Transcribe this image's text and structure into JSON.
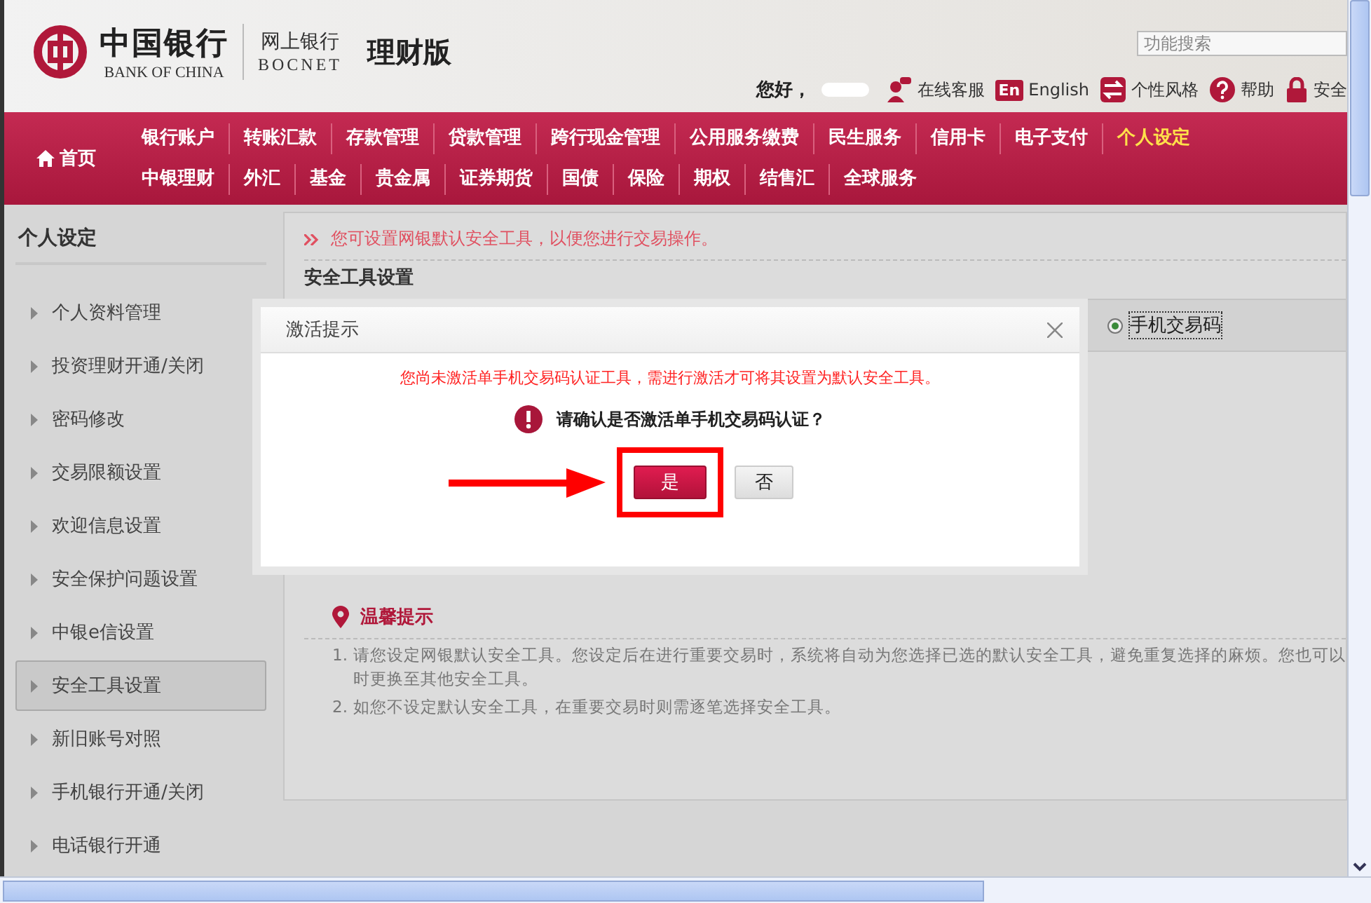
{
  "header": {
    "logo_cn": "中国银行",
    "logo_en": "BANK OF CHINA",
    "product_cn": "网上银行",
    "product_en": "BOCNET",
    "edition": "理财版",
    "search": {
      "placeholder": "功能搜索"
    },
    "greeting": "您好，",
    "links": [
      {
        "kind": "service",
        "label": "在线客服"
      },
      {
        "kind": "english",
        "icon_text": "En",
        "label": "English"
      },
      {
        "kind": "style",
        "label": "个性风格"
      },
      {
        "kind": "help",
        "label": "帮助"
      },
      {
        "kind": "security",
        "label": "安全"
      }
    ]
  },
  "nav": {
    "home": "首页",
    "primary_menu": [
      {
        "label": "银行账户",
        "selected": false
      },
      {
        "label": "转账汇款",
        "selected": false
      },
      {
        "label": "存款管理",
        "selected": false
      },
      {
        "label": "贷款管理",
        "selected": false
      },
      {
        "label": "跨行现金管理",
        "selected": false
      },
      {
        "label": "公用服务缴费",
        "selected": false
      },
      {
        "label": "民生服务",
        "selected": false
      },
      {
        "label": "信用卡",
        "selected": false
      },
      {
        "label": "电子支付",
        "selected": false
      },
      {
        "label": "个人设定",
        "selected": true
      }
    ],
    "secondary_menu": [
      {
        "label": "中银理财",
        "selected": false
      },
      {
        "label": "外汇",
        "selected": false
      },
      {
        "label": "基金",
        "selected": false
      },
      {
        "label": "贵金属",
        "selected": false
      },
      {
        "label": "证券期货",
        "selected": false
      },
      {
        "label": "国债",
        "selected": false
      },
      {
        "label": "保险",
        "selected": false
      },
      {
        "label": "期权",
        "selected": false
      },
      {
        "label": "结售汇",
        "selected": false
      },
      {
        "label": "全球服务",
        "selected": false
      }
    ]
  },
  "sidebar": {
    "title": "个人设定",
    "items": [
      {
        "label": "个人资料管理",
        "selected": false
      },
      {
        "label": "投资理财开通/关闭",
        "selected": false
      },
      {
        "label": "密码修改",
        "selected": false
      },
      {
        "label": "交易限额设置",
        "selected": false
      },
      {
        "label": "欢迎信息设置",
        "selected": false
      },
      {
        "label": "安全保护问题设置",
        "selected": false
      },
      {
        "label": "中银e信设置",
        "selected": false
      },
      {
        "label": "安全工具设置",
        "selected": true
      },
      {
        "label": "新旧账号对照",
        "selected": false
      },
      {
        "label": "手机银行开通/关闭",
        "selected": false
      },
      {
        "label": "电话银行开通",
        "selected": false
      }
    ]
  },
  "main": {
    "notice": "您可设置网银默认安全工具，以便您进行交易操作。",
    "section_title": "安全工具设置",
    "tool_option": {
      "label": "手机交易码",
      "selected": true
    },
    "tips": {
      "title": "温馨提示",
      "items": [
        {
          "number": "1.",
          "lines": [
            "请您设定网银默认安全工具。您设定后在进行重要交易时，系统将自动为您选择已选的默认安全工具，避免重复选择的麻烦。您也可以",
            "时更换至其他安全工具。"
          ]
        },
        {
          "number": "2.",
          "lines": [
            "如您不设定默认安全工具，在重要交易时则需逐笔选择安全工具。"
          ]
        }
      ]
    }
  },
  "dialog": {
    "title": "激活提示",
    "warning": "您尚未激活单手机交易码认证工具，需进行激活才可将其设置为默认安全工具。",
    "question": "请确认是否激活单手机交易码认证？",
    "buttons": [
      {
        "kind": "primary",
        "label": "是"
      },
      {
        "kind": "secondary",
        "label": "否"
      }
    ]
  }
}
